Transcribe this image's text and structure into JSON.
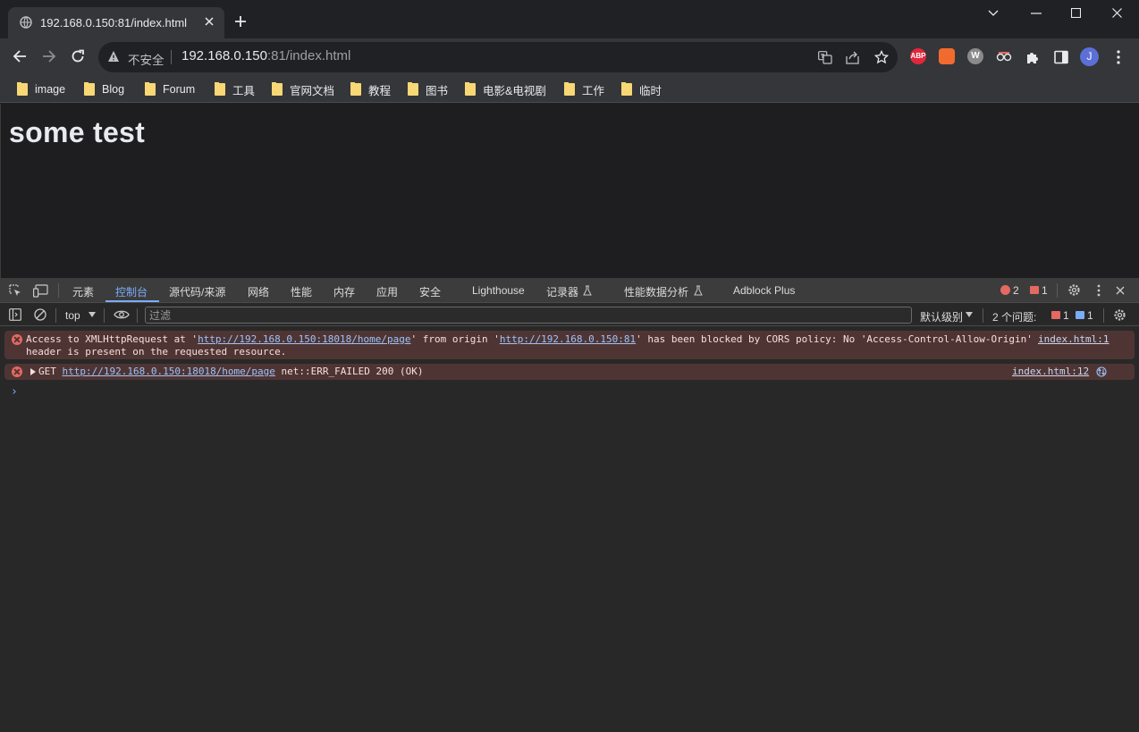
{
  "browser": {
    "tab_title": "192.168.0.150:81/index.html",
    "new_tab_symbol": "+",
    "omnibox": {
      "security_label": "不安全",
      "url_host": "192.168.0.150",
      "url_rest": ":81/index.html"
    },
    "profile_initial": "J",
    "extensions": [
      "ABP",
      "W"
    ],
    "bookmarks": [
      "image",
      "Blog",
      "Forum",
      "工具",
      "官网文档",
      "教程",
      "图书",
      "电影&电视剧",
      "工作",
      "临时"
    ]
  },
  "page": {
    "heading": "some test"
  },
  "devtools": {
    "tabs": [
      "元素",
      "控制台",
      "源代码/来源",
      "网络",
      "性能",
      "内存",
      "应用",
      "安全",
      "Lighthouse",
      "记录器",
      "性能数据分析",
      "Adblock Plus"
    ],
    "active_tab": "控制台",
    "error_count": "2",
    "issue_count": "1",
    "console_bar": {
      "context": "top",
      "filter_placeholder": "过滤",
      "level": "默认级别",
      "issues_label": "2 个问题:",
      "issue_errors": "1",
      "issue_info": "1"
    },
    "messages": [
      {
        "text_before": "Access to XMLHttpRequest at '",
        "link1": "http://192.168.0.150:18018/home/page",
        "text_mid": "' from origin '",
        "link2": "http://192.168.0.150:81",
        "text_after": "' has been blocked by CORS policy: No 'Access-Control-Allow-Origin'",
        "line2": "header is present on the requested resource.",
        "source": "index.html:1"
      },
      {
        "method": "GET",
        "link": "http://192.168.0.150:18018/home/page",
        "status": "net::ERR_FAILED 200 (OK)",
        "source": "index.html:12"
      }
    ],
    "prompt": "›"
  },
  "colors": {
    "accent": "#7cacf8",
    "error_bg": "#4e3534",
    "error_icon": "#e46962"
  }
}
